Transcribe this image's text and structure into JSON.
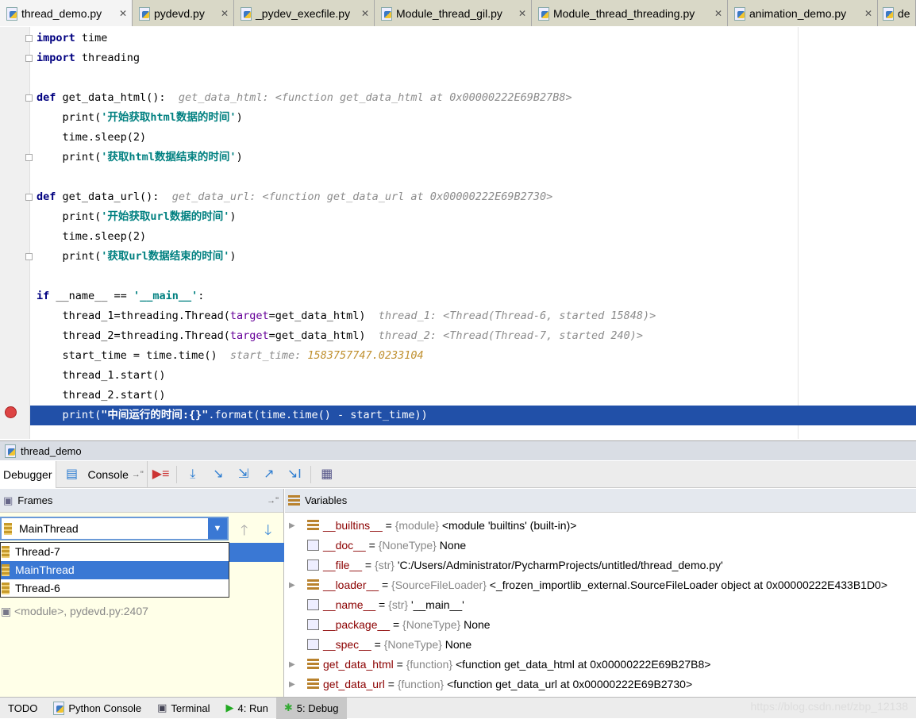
{
  "tabs": [
    {
      "label": "thread_demo.py",
      "active": true
    },
    {
      "label": "pydevd.py"
    },
    {
      "label": "_pydev_execfile.py"
    },
    {
      "label": "Module_thread_gil.py"
    },
    {
      "label": "Module_thread_threading.py"
    },
    {
      "label": "animation_demo.py"
    },
    {
      "label": "de"
    }
  ],
  "code": [
    [
      [
        "kw",
        "import"
      ],
      [
        "p",
        " time"
      ]
    ],
    [
      [
        "kw",
        "import"
      ],
      [
        "p",
        " threading"
      ]
    ],
    [],
    [
      [
        "kw",
        "def"
      ],
      [
        "p",
        " get_data_html():  "
      ],
      [
        "hint",
        "get_data_html: <function get_data_html at 0x00000222E69B27B8>"
      ]
    ],
    [
      [
        "p",
        "    print("
      ],
      [
        "str",
        "'开始获取html数据的时间'"
      ],
      [
        "p",
        ")"
      ]
    ],
    [
      [
        "p",
        "    time.sleep(2)"
      ]
    ],
    [
      [
        "p",
        "    print("
      ],
      [
        "str",
        "'获取html数据结束的时间'"
      ],
      [
        "p",
        ")"
      ]
    ],
    [],
    [
      [
        "kw",
        "def"
      ],
      [
        "p",
        " get_data_url():  "
      ],
      [
        "hint",
        "get_data_url: <function get_data_url at 0x00000222E69B2730>"
      ]
    ],
    [
      [
        "p",
        "    print("
      ],
      [
        "str",
        "'开始获取url数据的时间'"
      ],
      [
        "p",
        ")"
      ]
    ],
    [
      [
        "p",
        "    time.sleep(2)"
      ]
    ],
    [
      [
        "p",
        "    print("
      ],
      [
        "str",
        "'获取url数据结束的时间'"
      ],
      [
        "p",
        ")"
      ]
    ],
    [],
    [
      [
        "kw",
        "if"
      ],
      [
        "p",
        " __name__ == "
      ],
      [
        "str",
        "'__main__'"
      ],
      [
        "p",
        ":"
      ]
    ],
    [
      [
        "p",
        "    thread_1=threading.Thread("
      ],
      [
        "param",
        "target"
      ],
      [
        "p",
        "=get_data_html)  "
      ],
      [
        "hint",
        "thread_1: <Thread(Thread-6, started 15848)>"
      ]
    ],
    [
      [
        "p",
        "    thread_2=threading.Thread("
      ],
      [
        "param",
        "target"
      ],
      [
        "p",
        "=get_data_html)  "
      ],
      [
        "hint",
        "thread_2: <Thread(Thread-7, started 240)>"
      ]
    ],
    [
      [
        "p",
        "    start_time = time.time()  "
      ],
      [
        "hint",
        "start_time: "
      ],
      [
        "hintval",
        "1583757747.0233104"
      ]
    ],
    [
      [
        "p",
        "    thread_1.start()"
      ]
    ],
    [
      [
        "p",
        "    thread_2.start()"
      ]
    ],
    [
      [
        "p",
        "    print("
      ],
      [
        "str",
        "\"中间运行的时间:{}\""
      ],
      [
        "p",
        ".format(time.time() - start_time))"
      ]
    ]
  ],
  "highlighted_line": 20,
  "breakpoint_line": 20,
  "debug": {
    "title": "thread_demo",
    "tab_debugger": "Debugger",
    "tab_console": "Console",
    "frames_label": "Frames",
    "variables_label": "Variables",
    "thread_selected": "MainThread",
    "thread_options": [
      "Thread-7",
      "MainThread",
      "Thread-6"
    ],
    "frame_module": "<module>, pydevd.py:2407",
    "variables": [
      {
        "name": "__builtins__",
        "type": "{module}",
        "value": "<module 'builtins' (built-in)>",
        "expandable": true
      },
      {
        "name": "__doc__",
        "type": "{NoneType}",
        "value": "None",
        "expandable": false
      },
      {
        "name": "__file__",
        "type": "{str}",
        "value": "'C:/Users/Administrator/PycharmProjects/untitled/thread_demo.py'",
        "expandable": false
      },
      {
        "name": "__loader__",
        "type": "{SourceFileLoader}",
        "value": "<_frozen_importlib_external.SourceFileLoader object at 0x00000222E433B1D0>",
        "expandable": true
      },
      {
        "name": "__name__",
        "type": "{str}",
        "value": "'__main__'",
        "expandable": false
      },
      {
        "name": "__package__",
        "type": "{NoneType}",
        "value": "None",
        "expandable": false
      },
      {
        "name": "__spec__",
        "type": "{NoneType}",
        "value": "None",
        "expandable": false
      },
      {
        "name": "get_data_html",
        "type": "{function}",
        "value": "<function get_data_html at 0x00000222E69B27B8>",
        "expandable": true
      },
      {
        "name": "get_data_url",
        "type": "{function}",
        "value": "<function get_data_url at 0x00000222E69B2730>",
        "expandable": true
      }
    ]
  },
  "bottom": {
    "todo": "TODO",
    "python_console": "Python Console",
    "terminal": "Terminal",
    "run": "4: Run",
    "debug": "5: Debug"
  },
  "watermark": "https://blog.csdn.net/zbp_12138"
}
